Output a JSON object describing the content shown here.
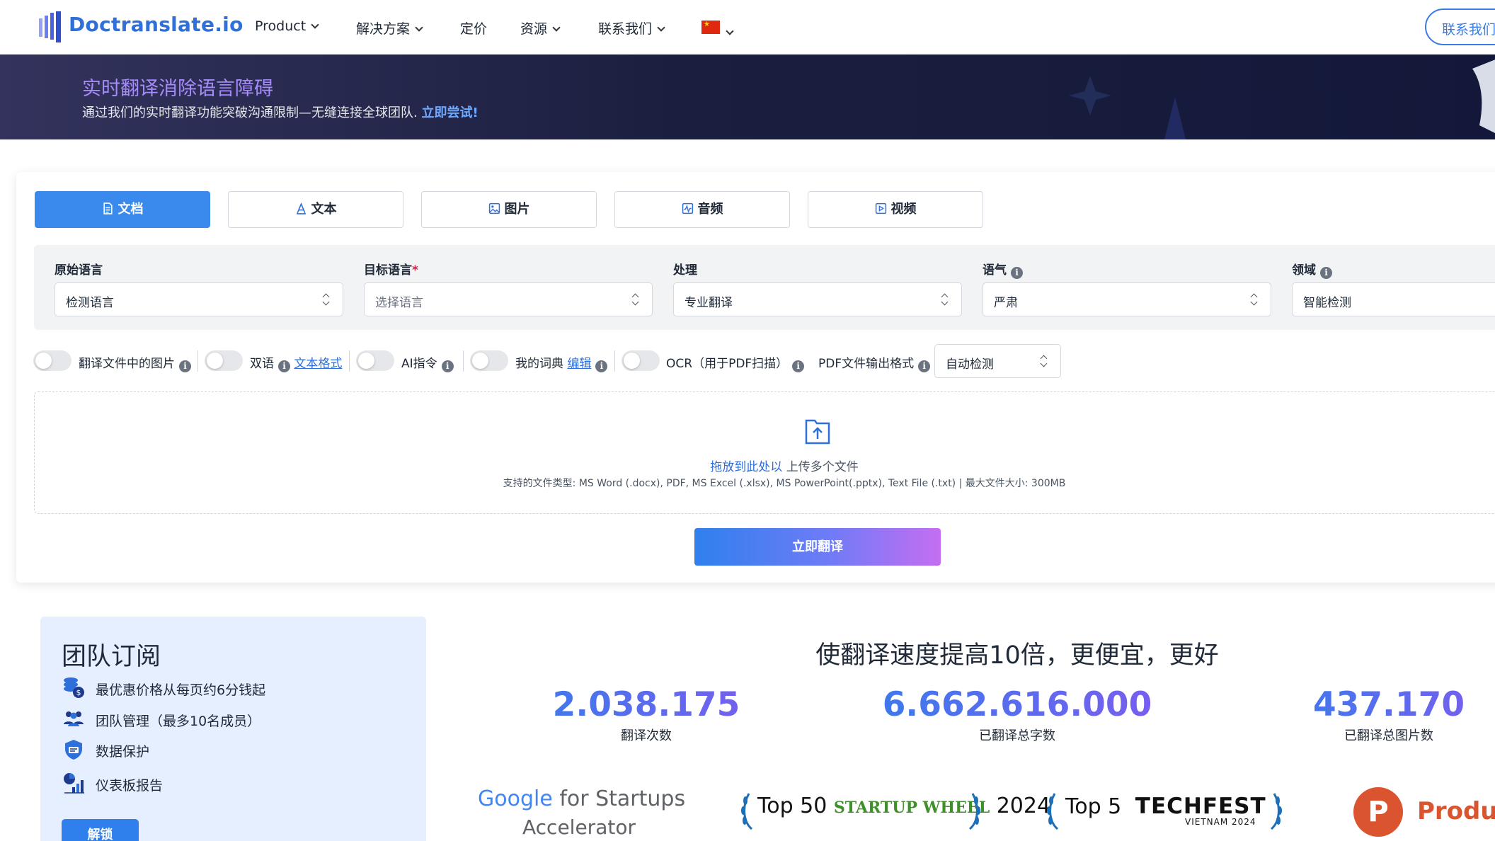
{
  "nav": {
    "brand": "Doctranslate.io",
    "items": [
      "Product",
      "解决方案",
      "定价",
      "资源",
      "联系我们"
    ],
    "contact_button": "联系我们"
  },
  "banner": {
    "title": "实时翻译消除语言障碍",
    "subtitle": "通过我们的实时翻译功能突破沟通限制—无缝连接全球团队.",
    "cta": "立即尝试!"
  },
  "tabs": [
    "文档",
    "文本",
    "图片",
    "音频",
    "视频"
  ],
  "options": {
    "source_label": "原始语言",
    "source_value": "检测语言",
    "target_label": "目标语言",
    "target_required_mark": "*",
    "target_placeholder": "选择语言",
    "process_label": "处理",
    "process_value": "专业翻译",
    "tone_label": "语气",
    "tone_value": "严肃",
    "domain_label": "领域",
    "domain_value": "智能检测"
  },
  "toggles": {
    "translate_images": "翻译文件中的图片",
    "bilingual": "双语",
    "text_format_link": "文本格式",
    "ai_prompt": "AI指令",
    "glossary": "我的词典",
    "edit_link": "编辑",
    "ocr": "OCR（用于PDF扫描）",
    "pdf_output_label": "PDF文件输出格式",
    "pdf_output_value": "自动检测"
  },
  "upload": {
    "drop_link": "拖放到此处以",
    "drop_text": "上传多个文件",
    "supported": "支持的文件类型: MS Word (.docx), PDF, MS Excel (.xlsx), MS PowerPoint(.pptx), Text File (.txt) | 最大文件大小: 300MB"
  },
  "translate_button": "立即翻译",
  "team": {
    "title": "团队订阅",
    "items": [
      "最优惠价格从每页约6分钱起",
      "团队管理（最多10名成员）",
      "数据保护",
      "仪表板报告"
    ],
    "unlock_button": "解锁"
  },
  "stats": {
    "title": "使翻译速度提高10倍，更便宜，更好",
    "items": [
      {
        "value": "2.038.175",
        "label": "翻译次数"
      },
      {
        "value": "6.662.616.000",
        "label": "已翻译总字数"
      },
      {
        "value": "437.170",
        "label": "已翻译总图片数"
      }
    ]
  },
  "partners": {
    "google_line1_brand": "Google",
    "google_line1_rest": " for Startups",
    "google_line2": "Accelerator",
    "award1_rank": "Top 50",
    "award1_name": "STARTUP WHEEL",
    "award1_year": "2024",
    "award2_rank": "Top 5",
    "award2_name": "TECHFEST",
    "award2_sub": "VIETNAM 2024",
    "producthunt_letter": "P",
    "producthunt_text": "Produc"
  },
  "colors": {
    "brand_blue": "#2f6fd9",
    "active_tab": "#3a89ec",
    "banner_title": "#a78bfa",
    "product_hunt": "#da552f"
  }
}
